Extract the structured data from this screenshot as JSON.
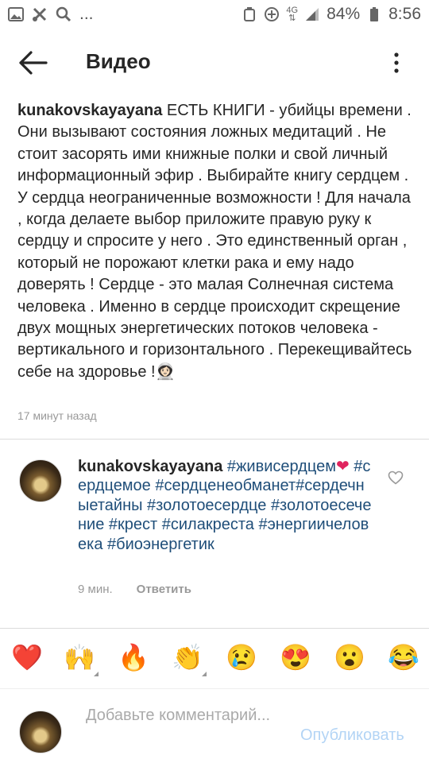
{
  "status_bar": {
    "network": "4G",
    "battery": "84%",
    "time": "8:56",
    "ellipsis": "..."
  },
  "header": {
    "title": "Видео"
  },
  "caption": {
    "username": "kunakovskayayana",
    "text": " ЕСТЬ КНИГИ - убийцы времени . Они вызывают состояния ложных медитаций . Не стоит засорять ими книжные полки и свой личный информационный эфир . Выбирайте книгу сердцем . У сердца неограниченные возможности ! Для начала , когда делаете выбор приложите правую руку к сердцу и спросите у него . Это единственный орган , который не порожают клетки рака и ему надо доверять ! Сердце - это малая Солнечная система человека . Именно в сердце происходит скрещение двух мощных энергетических потоков человека - вертикального и горизонтального . Перекещивайтесь себе на здоровье !",
    "end_emoji": "👩🏻‍🚀",
    "timestamp": "17 минут назад"
  },
  "comment": {
    "username": "kunakovskayayana",
    "hashtags": [
      "#живисердцем",
      "#сердцемое",
      "#сердценеобманет",
      "#сердечныетайны",
      "#золотоесердце",
      "#золотоесечение",
      "#крест",
      "#силакреста",
      "#энергиичеловека",
      "#биоэнергетик"
    ],
    "heart": "❤",
    "time": "9 мин.",
    "reply_label": "Ответить"
  },
  "emoji_bar": [
    "❤️",
    "🙌",
    "🔥",
    "👏",
    "😢",
    "😍",
    "😮",
    "😂"
  ],
  "input": {
    "placeholder": "Добавьте комментарий...",
    "publish_label": "Опубликовать"
  },
  "colors": {
    "hashtag": "#1f4e79",
    "publish_disabled": "#b3d4f5",
    "muted": "#999999"
  }
}
